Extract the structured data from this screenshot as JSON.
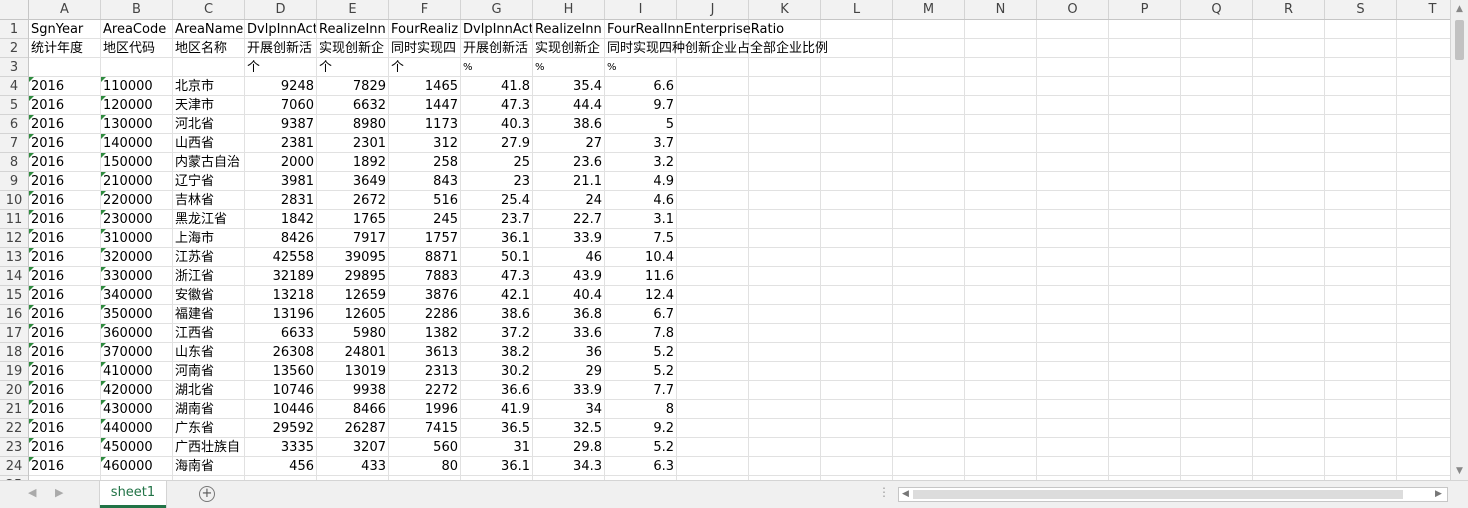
{
  "columns": [
    "A",
    "B",
    "C",
    "D",
    "E",
    "F",
    "G",
    "H",
    "I",
    "J",
    "K",
    "L",
    "M",
    "N",
    "O",
    "P",
    "Q",
    "R",
    "S",
    "T"
  ],
  "rows": [
    [
      "SgnYear",
      "AreaCode",
      "AreaName",
      "DvlpInnAct",
      "RealizeInn",
      "FourRealiz",
      "DvlpInnAct",
      "RealizeInn",
      "FourRealInnEnterpriseRatio"
    ],
    [
      "统计年度",
      "地区代码",
      "地区名称",
      "开展创新活",
      "实现创新企",
      "同时实现四",
      "开展创新活",
      "实现创新企",
      "同时实现四种创新企业占全部企业比例"
    ],
    [
      "",
      "",
      "",
      "个",
      "个",
      "个",
      "%",
      "%",
      "%"
    ],
    [
      "2016",
      "110000",
      "北京市",
      "9248",
      "7829",
      "1465",
      "41.8",
      "35.4",
      "6.6"
    ],
    [
      "2016",
      "120000",
      "天津市",
      "7060",
      "6632",
      "1447",
      "47.3",
      "44.4",
      "9.7"
    ],
    [
      "2016",
      "130000",
      "河北省",
      "9387",
      "8980",
      "1173",
      "40.3",
      "38.6",
      "5"
    ],
    [
      "2016",
      "140000",
      "山西省",
      "2381",
      "2301",
      "312",
      "27.9",
      "27",
      "3.7"
    ],
    [
      "2016",
      "150000",
      "内蒙古自治",
      "2000",
      "1892",
      "258",
      "25",
      "23.6",
      "3.2"
    ],
    [
      "2016",
      "210000",
      "辽宁省",
      "3981",
      "3649",
      "843",
      "23",
      "21.1",
      "4.9"
    ],
    [
      "2016",
      "220000",
      "吉林省",
      "2831",
      "2672",
      "516",
      "25.4",
      "24",
      "4.6"
    ],
    [
      "2016",
      "230000",
      "黑龙江省",
      "1842",
      "1765",
      "245",
      "23.7",
      "22.7",
      "3.1"
    ],
    [
      "2016",
      "310000",
      "上海市",
      "8426",
      "7917",
      "1757",
      "36.1",
      "33.9",
      "7.5"
    ],
    [
      "2016",
      "320000",
      "江苏省",
      "42558",
      "39095",
      "8871",
      "50.1",
      "46",
      "10.4"
    ],
    [
      "2016",
      "330000",
      "浙江省",
      "32189",
      "29895",
      "7883",
      "47.3",
      "43.9",
      "11.6"
    ],
    [
      "2016",
      "340000",
      "安徽省",
      "13218",
      "12659",
      "3876",
      "42.1",
      "40.4",
      "12.4"
    ],
    [
      "2016",
      "350000",
      "福建省",
      "13196",
      "12605",
      "2286",
      "38.6",
      "36.8",
      "6.7"
    ],
    [
      "2016",
      "360000",
      "江西省",
      "6633",
      "5980",
      "1382",
      "37.2",
      "33.6",
      "7.8"
    ],
    [
      "2016",
      "370000",
      "山东省",
      "26308",
      "24801",
      "3613",
      "38.2",
      "36",
      "5.2"
    ],
    [
      "2016",
      "410000",
      "河南省",
      "13560",
      "13019",
      "2313",
      "30.2",
      "29",
      "5.2"
    ],
    [
      "2016",
      "420000",
      "湖北省",
      "10746",
      "9938",
      "2272",
      "36.6",
      "33.9",
      "7.7"
    ],
    [
      "2016",
      "430000",
      "湖南省",
      "10446",
      "8466",
      "1996",
      "41.9",
      "34",
      "8"
    ],
    [
      "2016",
      "440000",
      "广东省",
      "29592",
      "26287",
      "7415",
      "36.5",
      "32.5",
      "9.2"
    ],
    [
      "2016",
      "450000",
      "广西壮族自",
      "3335",
      "3207",
      "560",
      "31",
      "29.8",
      "5.2"
    ],
    [
      "2016",
      "460000",
      "海南省",
      "456",
      "433",
      "80",
      "36.1",
      "34.3",
      "6.3"
    ]
  ],
  "sheet_tab": "sheet1",
  "add_sheet_symbol": "+",
  "accent": "#217346"
}
